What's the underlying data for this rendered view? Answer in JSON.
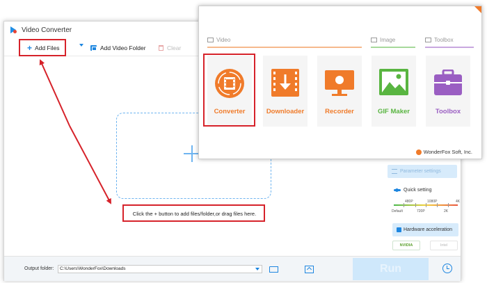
{
  "window": {
    "title": "Video Converter"
  },
  "toolbar": {
    "add_files": "Add Files",
    "add_folder": "Add Video Folder",
    "clear": "Clear"
  },
  "drop_hint": "Click the + button to add files/folder,or drag files here.",
  "side": {
    "parameter_settings": "Parameter settings",
    "quick_setting": "Quick setting",
    "quality_top": [
      "480P",
      "1080P",
      "4K"
    ],
    "quality_bottom": [
      "Default",
      "720P",
      "2K"
    ],
    "hw_accel": "Hardware acceleration",
    "gpu_nvidia": "NVIDIA",
    "gpu_intel": "Intel"
  },
  "bottom": {
    "output_label": "Output folder:",
    "output_path": "C:\\Users\\WonderFox\\Downloads",
    "run": "Run"
  },
  "launcher": {
    "sections": [
      "Video",
      "Image",
      "Toolbox"
    ],
    "tiles": [
      {
        "label": "Converter",
        "color": "#f07b2a",
        "icon": "film-icon"
      },
      {
        "label": "Downloader",
        "color": "#f07b2a",
        "icon": "download-icon"
      },
      {
        "label": "Recorder",
        "color": "#f07b2a",
        "icon": "screen-record-icon"
      },
      {
        "label": "GIF Maker",
        "color": "#59b541",
        "icon": "image-icon"
      },
      {
        "label": "Toolbox",
        "color": "#9a5ec2",
        "icon": "toolbox-icon"
      }
    ],
    "brand": "WonderFox Soft, Inc."
  },
  "colors": {
    "accent": "#1d86e0",
    "annotation": "#d6222a",
    "video_orange": "#f07b2a",
    "image_green": "#59b541",
    "toolbox_purple": "#9a5ec2"
  }
}
